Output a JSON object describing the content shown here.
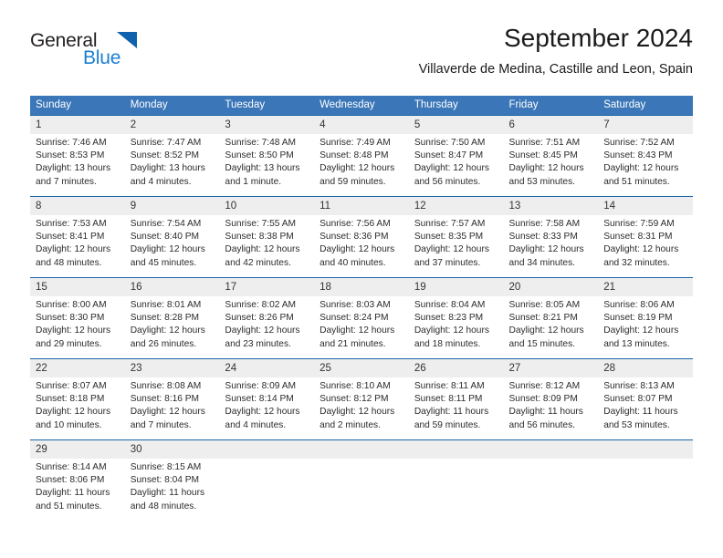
{
  "logo": {
    "word_top": "General",
    "word_bottom": "Blue",
    "triangle_color": "#1061ad",
    "blue_color": "#1c7fd1"
  },
  "header": {
    "title": "September 2024",
    "subtitle": "Villaverde de Medina, Castille and Leon, Spain"
  },
  "theme": {
    "header_blue": "#3a76b8",
    "row_rule_blue": "#1c63a8",
    "daynum_band": "#eeeeee"
  },
  "weekdays": [
    "Sunday",
    "Monday",
    "Tuesday",
    "Wednesday",
    "Thursday",
    "Friday",
    "Saturday"
  ],
  "weeks": [
    [
      {
        "day": "1",
        "sunrise": "Sunrise: 7:46 AM",
        "sunset": "Sunset: 8:53 PM",
        "daylight1": "Daylight: 13 hours",
        "daylight2": "and 7 minutes."
      },
      {
        "day": "2",
        "sunrise": "Sunrise: 7:47 AM",
        "sunset": "Sunset: 8:52 PM",
        "daylight1": "Daylight: 13 hours",
        "daylight2": "and 4 minutes."
      },
      {
        "day": "3",
        "sunrise": "Sunrise: 7:48 AM",
        "sunset": "Sunset: 8:50 PM",
        "daylight1": "Daylight: 13 hours",
        "daylight2": "and 1 minute."
      },
      {
        "day": "4",
        "sunrise": "Sunrise: 7:49 AM",
        "sunset": "Sunset: 8:48 PM",
        "daylight1": "Daylight: 12 hours",
        "daylight2": "and 59 minutes."
      },
      {
        "day": "5",
        "sunrise": "Sunrise: 7:50 AM",
        "sunset": "Sunset: 8:47 PM",
        "daylight1": "Daylight: 12 hours",
        "daylight2": "and 56 minutes."
      },
      {
        "day": "6",
        "sunrise": "Sunrise: 7:51 AM",
        "sunset": "Sunset: 8:45 PM",
        "daylight1": "Daylight: 12 hours",
        "daylight2": "and 53 minutes."
      },
      {
        "day": "7",
        "sunrise": "Sunrise: 7:52 AM",
        "sunset": "Sunset: 8:43 PM",
        "daylight1": "Daylight: 12 hours",
        "daylight2": "and 51 minutes."
      }
    ],
    [
      {
        "day": "8",
        "sunrise": "Sunrise: 7:53 AM",
        "sunset": "Sunset: 8:41 PM",
        "daylight1": "Daylight: 12 hours",
        "daylight2": "and 48 minutes."
      },
      {
        "day": "9",
        "sunrise": "Sunrise: 7:54 AM",
        "sunset": "Sunset: 8:40 PM",
        "daylight1": "Daylight: 12 hours",
        "daylight2": "and 45 minutes."
      },
      {
        "day": "10",
        "sunrise": "Sunrise: 7:55 AM",
        "sunset": "Sunset: 8:38 PM",
        "daylight1": "Daylight: 12 hours",
        "daylight2": "and 42 minutes."
      },
      {
        "day": "11",
        "sunrise": "Sunrise: 7:56 AM",
        "sunset": "Sunset: 8:36 PM",
        "daylight1": "Daylight: 12 hours",
        "daylight2": "and 40 minutes."
      },
      {
        "day": "12",
        "sunrise": "Sunrise: 7:57 AM",
        "sunset": "Sunset: 8:35 PM",
        "daylight1": "Daylight: 12 hours",
        "daylight2": "and 37 minutes."
      },
      {
        "day": "13",
        "sunrise": "Sunrise: 7:58 AM",
        "sunset": "Sunset: 8:33 PM",
        "daylight1": "Daylight: 12 hours",
        "daylight2": "and 34 minutes."
      },
      {
        "day": "14",
        "sunrise": "Sunrise: 7:59 AM",
        "sunset": "Sunset: 8:31 PM",
        "daylight1": "Daylight: 12 hours",
        "daylight2": "and 32 minutes."
      }
    ],
    [
      {
        "day": "15",
        "sunrise": "Sunrise: 8:00 AM",
        "sunset": "Sunset: 8:30 PM",
        "daylight1": "Daylight: 12 hours",
        "daylight2": "and 29 minutes."
      },
      {
        "day": "16",
        "sunrise": "Sunrise: 8:01 AM",
        "sunset": "Sunset: 8:28 PM",
        "daylight1": "Daylight: 12 hours",
        "daylight2": "and 26 minutes."
      },
      {
        "day": "17",
        "sunrise": "Sunrise: 8:02 AM",
        "sunset": "Sunset: 8:26 PM",
        "daylight1": "Daylight: 12 hours",
        "daylight2": "and 23 minutes."
      },
      {
        "day": "18",
        "sunrise": "Sunrise: 8:03 AM",
        "sunset": "Sunset: 8:24 PM",
        "daylight1": "Daylight: 12 hours",
        "daylight2": "and 21 minutes."
      },
      {
        "day": "19",
        "sunrise": "Sunrise: 8:04 AM",
        "sunset": "Sunset: 8:23 PM",
        "daylight1": "Daylight: 12 hours",
        "daylight2": "and 18 minutes."
      },
      {
        "day": "20",
        "sunrise": "Sunrise: 8:05 AM",
        "sunset": "Sunset: 8:21 PM",
        "daylight1": "Daylight: 12 hours",
        "daylight2": "and 15 minutes."
      },
      {
        "day": "21",
        "sunrise": "Sunrise: 8:06 AM",
        "sunset": "Sunset: 8:19 PM",
        "daylight1": "Daylight: 12 hours",
        "daylight2": "and 13 minutes."
      }
    ],
    [
      {
        "day": "22",
        "sunrise": "Sunrise: 8:07 AM",
        "sunset": "Sunset: 8:18 PM",
        "daylight1": "Daylight: 12 hours",
        "daylight2": "and 10 minutes."
      },
      {
        "day": "23",
        "sunrise": "Sunrise: 8:08 AM",
        "sunset": "Sunset: 8:16 PM",
        "daylight1": "Daylight: 12 hours",
        "daylight2": "and 7 minutes."
      },
      {
        "day": "24",
        "sunrise": "Sunrise: 8:09 AM",
        "sunset": "Sunset: 8:14 PM",
        "daylight1": "Daylight: 12 hours",
        "daylight2": "and 4 minutes."
      },
      {
        "day": "25",
        "sunrise": "Sunrise: 8:10 AM",
        "sunset": "Sunset: 8:12 PM",
        "daylight1": "Daylight: 12 hours",
        "daylight2": "and 2 minutes."
      },
      {
        "day": "26",
        "sunrise": "Sunrise: 8:11 AM",
        "sunset": "Sunset: 8:11 PM",
        "daylight1": "Daylight: 11 hours",
        "daylight2": "and 59 minutes."
      },
      {
        "day": "27",
        "sunrise": "Sunrise: 8:12 AM",
        "sunset": "Sunset: 8:09 PM",
        "daylight1": "Daylight: 11 hours",
        "daylight2": "and 56 minutes."
      },
      {
        "day": "28",
        "sunrise": "Sunrise: 8:13 AM",
        "sunset": "Sunset: 8:07 PM",
        "daylight1": "Daylight: 11 hours",
        "daylight2": "and 53 minutes."
      }
    ],
    [
      {
        "day": "29",
        "sunrise": "Sunrise: 8:14 AM",
        "sunset": "Sunset: 8:06 PM",
        "daylight1": "Daylight: 11 hours",
        "daylight2": "and 51 minutes."
      },
      {
        "day": "30",
        "sunrise": "Sunrise: 8:15 AM",
        "sunset": "Sunset: 8:04 PM",
        "daylight1": "Daylight: 11 hours",
        "daylight2": "and 48 minutes."
      },
      {
        "day": "",
        "sunrise": "",
        "sunset": "",
        "daylight1": "",
        "daylight2": ""
      },
      {
        "day": "",
        "sunrise": "",
        "sunset": "",
        "daylight1": "",
        "daylight2": ""
      },
      {
        "day": "",
        "sunrise": "",
        "sunset": "",
        "daylight1": "",
        "daylight2": ""
      },
      {
        "day": "",
        "sunrise": "",
        "sunset": "",
        "daylight1": "",
        "daylight2": ""
      },
      {
        "day": "",
        "sunrise": "",
        "sunset": "",
        "daylight1": "",
        "daylight2": ""
      }
    ]
  ]
}
